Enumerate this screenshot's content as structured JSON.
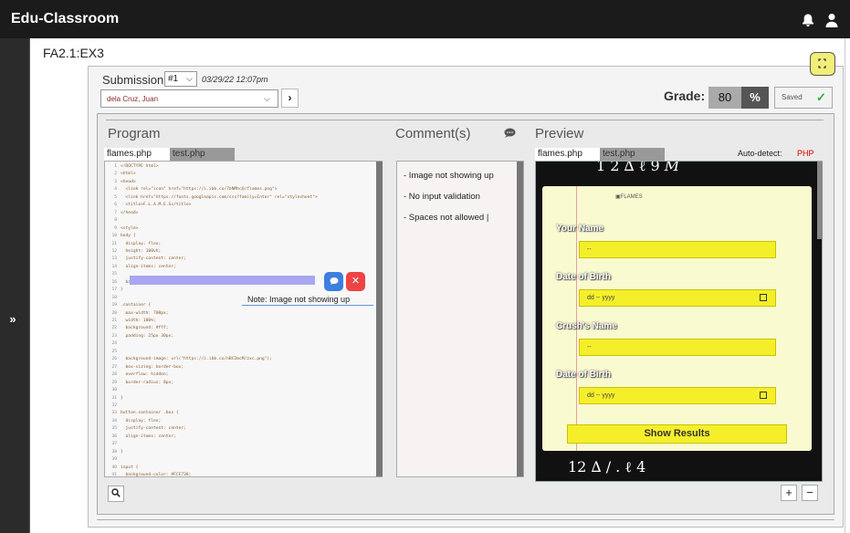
{
  "app": {
    "title": "Edu-Classroom"
  },
  "page": {
    "title": "FA2.1:EX3"
  },
  "submission": {
    "label": "Submission",
    "number": "#1",
    "timestamp": "03/29/22 12:07pm",
    "student": "dela Cruz, Juan"
  },
  "grade": {
    "label": "Grade:",
    "value": "80",
    "unit": "%",
    "status": "Saved"
  },
  "program": {
    "header": "Program",
    "tabs": [
      "flames.php",
      "test.php"
    ],
    "lines": [
      {
        "n": "1",
        "t": "<!DOCTYPE html>"
      },
      {
        "n": "2",
        "t": "<html>"
      },
      {
        "n": "3",
        "t": "<head>"
      },
      {
        "n": "4",
        "t": "  <link rel=\"icon\" href=\"https://i.ibb.co/7bNMhcQ/flames.png\">"
      },
      {
        "n": "5",
        "t": "  <link href=\"https://fonts.googleapis.com/css?family=Inter\" rel=\"stylesheet\">"
      },
      {
        "n": "6",
        "t": "  <title>F.L.A.M.E.S</title>"
      },
      {
        "n": "7",
        "t": "</head>"
      },
      {
        "n": "8",
        "t": ""
      },
      {
        "n": "9",
        "t": "<style>"
      },
      {
        "n": "10",
        "t": "body {"
      },
      {
        "n": "11",
        "t": "  display: flex;"
      },
      {
        "n": "12",
        "t": "  height: 100vh;"
      },
      {
        "n": "13",
        "t": "  justify-content: center;"
      },
      {
        "n": "14",
        "t": "  align-items: center;"
      },
      {
        "n": "15",
        "t": ""
      },
      {
        "n": "16",
        "t": "  background-image: url(\"https://i.ibb.co/Ddvx9k/image.png\");"
      },
      {
        "n": "17",
        "t": "}"
      },
      {
        "n": "18",
        "t": ""
      },
      {
        "n": "19",
        "t": ".container {"
      },
      {
        "n": "20",
        "t": "  max-width: 700px;"
      },
      {
        "n": "21",
        "t": "  width: 100%;"
      },
      {
        "n": "22",
        "t": "  background: #fff;"
      },
      {
        "n": "23",
        "t": "  padding: 25px 30px;"
      },
      {
        "n": "24",
        "t": ""
      },
      {
        "n": "25",
        "t": ""
      },
      {
        "n": "26",
        "t": "  background-image: url(\"https://i.ibb.co/nBC2mcM/zxc.png\");"
      },
      {
        "n": "27",
        "t": "  box-sizing: border-box;"
      },
      {
        "n": "28",
        "t": "  overflow: hidden;"
      },
      {
        "n": "29",
        "t": "  border-radius: 8px;"
      },
      {
        "n": "30",
        "t": ""
      },
      {
        "n": "31",
        "t": "}"
      },
      {
        "n": "32",
        "t": ""
      },
      {
        "n": "33",
        "t": "button.container .box {"
      },
      {
        "n": "34",
        "t": "  display: flex;"
      },
      {
        "n": "35",
        "t": "  justify-content: center;"
      },
      {
        "n": "36",
        "t": "  align-items: center;"
      },
      {
        "n": "37",
        "t": ""
      },
      {
        "n": "38",
        "t": "}"
      },
      {
        "n": "39",
        "t": ""
      },
      {
        "n": "40",
        "t": "input {"
      },
      {
        "n": "41",
        "t": "  background-color: #FCF738;"
      }
    ],
    "note": "Note: Image not showing up"
  },
  "comments": {
    "header": "Comment(s)",
    "items": [
      "- Image not showing up",
      "- No input validation",
      "- Spaces not allowed |"
    ]
  },
  "preview": {
    "header": "Preview",
    "tabs": [
      "flames.php",
      "test.php"
    ],
    "auto_detect_label": "Auto-detect:",
    "language": "PHP",
    "broken_image": "FLAMES",
    "fields": [
      {
        "label": "Your Name",
        "placeholder": "--"
      },
      {
        "label": "Date of Birth",
        "placeholder": "dd -- yyyy"
      },
      {
        "label": "Crush's Name",
        "placeholder": "--"
      },
      {
        "label": "Date of Birth",
        "placeholder": "dd -- yyyy"
      }
    ],
    "button": "Show Results"
  },
  "icons": [
    "bell-icon",
    "user-icon",
    "expand-sidebar-icon",
    "fullscreen-icon",
    "comment-icon",
    "search-icon",
    "zoom-in-icon",
    "zoom-out-icon",
    "comment-bubble-icon",
    "close-icon",
    "check-icon"
  ],
  "colors": {
    "topbar": "#1b1b1b",
    "accent_yellow": "#f5ef2a",
    "highlight": "#a9a6f0",
    "php": "#dd0000",
    "blue": "#3d7fe0",
    "red": "#ee4444"
  }
}
